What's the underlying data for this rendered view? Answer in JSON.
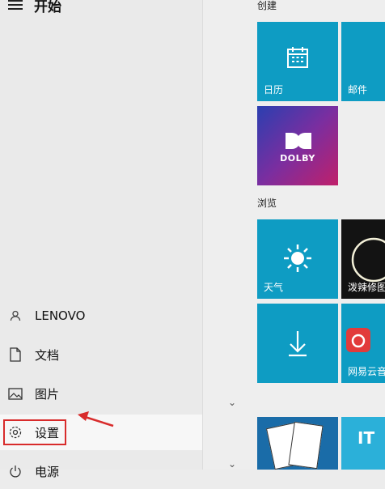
{
  "header": {
    "title": "开始"
  },
  "nav": {
    "user": "LENOVO",
    "documents": "文档",
    "pictures": "图片",
    "settings": "设置",
    "power": "电源"
  },
  "groups": {
    "create": "创建",
    "browse": "浏览"
  },
  "tiles": {
    "calendar": "日历",
    "mail": "邮件",
    "dolby": "DOLBY",
    "weather": "天气",
    "photo": "泼辣修图",
    "music": "网易云音"
  },
  "watermark": "IT",
  "colors": {
    "tile_blue": "#0e9cc3",
    "highlight_red": "#d82b2b"
  }
}
